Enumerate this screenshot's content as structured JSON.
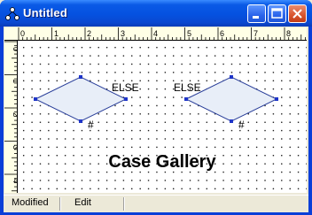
{
  "window": {
    "title": "Untitled"
  },
  "titlebar": {
    "minimize_icon": "minimize-icon",
    "maximize_icon": "maximize-icon",
    "close_icon": "close-icon"
  },
  "ruler": {
    "top_labels": [
      "0",
      "1",
      "2",
      "3",
      "4",
      "5",
      "6",
      "7",
      "8"
    ],
    "left_labels": [
      "0",
      "1",
      "2",
      "3",
      "4"
    ]
  },
  "canvas": {
    "shapes": [
      {
        "kind": "diamond",
        "label_else": "ELSE",
        "label_hash": "#"
      },
      {
        "kind": "diamond",
        "label_else": "ELSE",
        "label_hash": "#"
      }
    ],
    "title": "Case Gallery"
  },
  "status": {
    "mode": "Modified",
    "state": "Edit"
  },
  "colors": {
    "titlebar": "#0a5ae6",
    "diamond_fill": "#e8eef8",
    "diamond_stroke": "#2a3f9a",
    "handle": "#1f35c8"
  }
}
